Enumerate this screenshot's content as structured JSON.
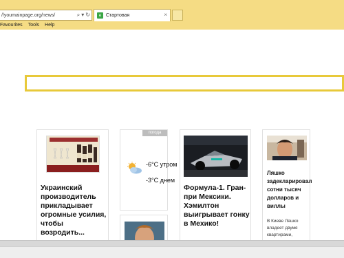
{
  "browser": {
    "address": "//youmainpage.org/news/",
    "tab_title": "Стартовая",
    "menu": [
      "Favourites",
      "Tools",
      "Help"
    ],
    "icons": [
      "search-icon",
      "dropdown-icon",
      "refresh-icon",
      "tab-favicon",
      "close-icon"
    ]
  },
  "weather": {
    "tag": "погода",
    "morning": "-6°C утром",
    "day": "-3°C днем"
  },
  "news": [
    {
      "title": "Украинский производитель прикладывает огромные усилия, чтобы возродить..."
    },
    {
      "title": "Формула-1. Гран-при Мексики. Хэмилтон выигрывает гонку в Мехико!"
    },
    {
      "title": "Ляшко задекларировал сотни тысяч долларов и виллы",
      "desc": "В Киеве Ляшко владеет двумя квартирами,"
    }
  ],
  "colors": {
    "chrome": "#f5dc84",
    "search_border": "#e8c93a"
  }
}
